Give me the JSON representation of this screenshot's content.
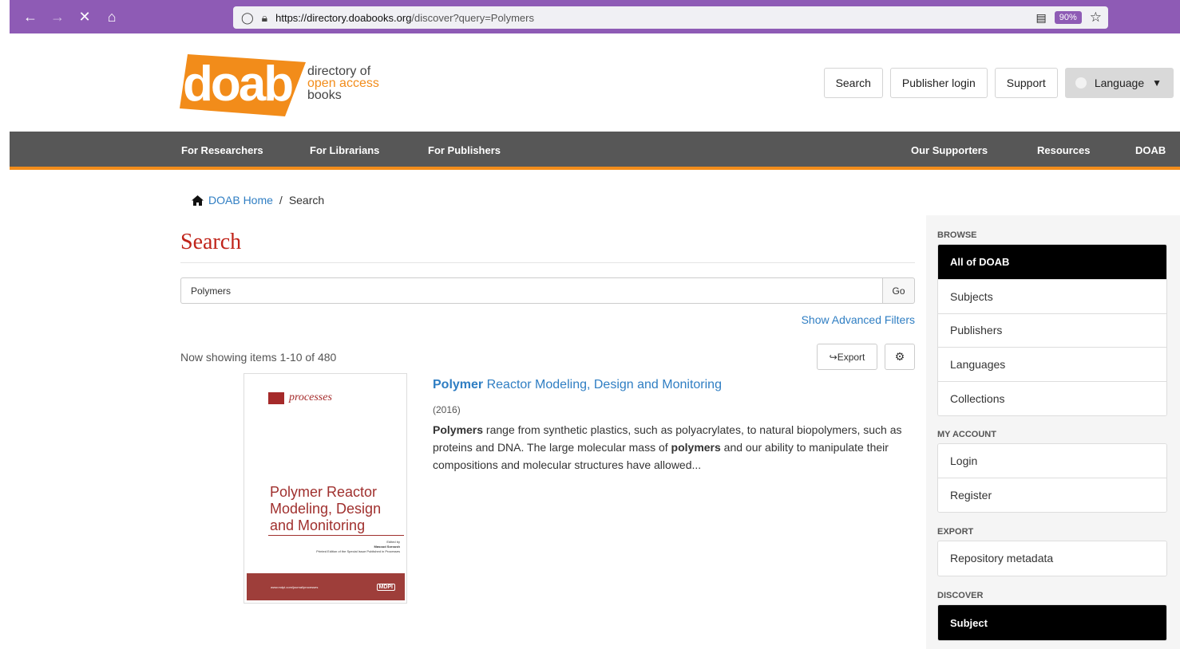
{
  "browser": {
    "url_domain": "https://directory.doabooks.org",
    "url_path": "/discover?query=Polymers",
    "zoom": "90%"
  },
  "logo": {
    "mark_text": "doab",
    "line1": "directory of",
    "line2": "open access",
    "line3": "books"
  },
  "header": {
    "search": "Search",
    "publisher_login": "Publisher login",
    "support": "Support",
    "language": "Language"
  },
  "main_nav": {
    "researchers": "For Researchers",
    "librarians": "For Librarians",
    "publishers": "For Publishers",
    "supporters": "Our Supporters",
    "resources": "Resources",
    "doab": "DOAB"
  },
  "breadcrumb": {
    "home": "DOAB Home",
    "sep": "/",
    "current": "Search"
  },
  "search": {
    "title": "Search",
    "query": "Polymers",
    "go": "Go",
    "advanced": "Show Advanced Filters",
    "showing": "Now showing items 1-10 of 480",
    "export": "Export"
  },
  "result": {
    "title_bold": "Polymer",
    "title_rest": " Reactor Modeling, Design and Monitoring",
    "year": "(2016)",
    "abstract_b1": "Polymers",
    "abstract_t1": " range from synthetic plastics, such as polyacrylates, to natural biopolymers, such as proteins and DNA. The large molecular mass of ",
    "abstract_b2": "polymers",
    "abstract_t2": " and our ability to manipulate their compositions and molecular structures have allowed...",
    "cover": {
      "journal": "processes",
      "title_l1": "Polymer Reactor",
      "title_l2": "Modeling, Design",
      "title_l3": "and Monitoring",
      "edited": "Edited by",
      "editor": "Masoud Soroush",
      "printed": "Printed Edition of the Special Issue Published in Processes",
      "band_url": "www.mdpi.com/journal/processes",
      "band_logo": "MDPI"
    }
  },
  "sidebar": {
    "browse_h": "Browse",
    "browse": [
      "All of DOAB",
      "Subjects",
      "Publishers",
      "Languages",
      "Collections"
    ],
    "account_h": "My Account",
    "account": [
      "Login",
      "Register"
    ],
    "export_h": "Export",
    "export": [
      "Repository metadata"
    ],
    "discover_h": "Discover",
    "discover": [
      "Subject"
    ]
  },
  "colors": {
    "browser_purple": "#8e5bb5",
    "brand_orange": "#f28c1a",
    "title_red": "#c0241a",
    "link_blue": "#2f7ec3",
    "nav_gray": "#575757"
  }
}
